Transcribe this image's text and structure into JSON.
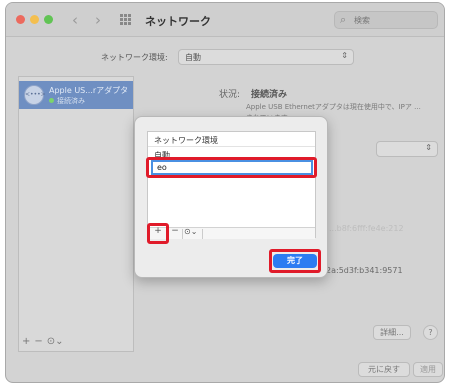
{
  "window": {
    "title": "ネットワーク",
    "search_placeholder": "検索"
  },
  "location": {
    "label": "ネットワーク環境:",
    "value": "自動"
  },
  "sidebar": {
    "service_name": "Apple US...rアダプタ",
    "service_status": "接続済み",
    "service_icon_text": "<•••>",
    "tools": [
      "+",
      "−",
      "⊙⌄"
    ]
  },
  "detail": {
    "status_label": "状況:",
    "status_value": "接続済み",
    "status_desc": "Apple USB Ethernetアダプタは現在使用中で、IPア ...されています。",
    "faded_text": "...b8f:6fff:fe4e:212",
    "mac_address": "2a:5d3f:b341:9571",
    "advanced_label": "詳細...",
    "help_label": "?",
    "revert_label": "元に戻す",
    "apply_label": "適用"
  },
  "dialog": {
    "list_header": "ネットワーク環境",
    "existing_item": "自動",
    "new_item_value": "eo",
    "add_label": "+",
    "remove_label": "−",
    "action_label": "⊙⌄",
    "done_label": "完了"
  },
  "colors": {
    "accent": "#2c7cf2",
    "highlight": "#e01b2a",
    "selection": "#6f8fc2"
  }
}
